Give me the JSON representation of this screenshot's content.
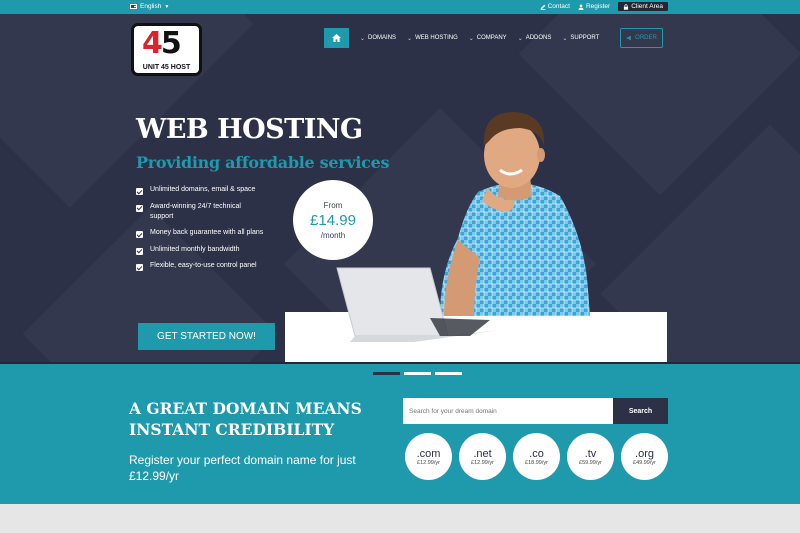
{
  "topbar": {
    "language": "English",
    "contact": "Contact",
    "register": "Register",
    "client_area": "Client Area"
  },
  "logo": {
    "digits_a": "4",
    "digits_b": "5",
    "text": "UNIT 45 HOST"
  },
  "nav": {
    "items": [
      "DOMAINS",
      "WEB HOSTING",
      "COMPANY",
      "ADDONS",
      "SUPPORT"
    ],
    "order": "ORDER"
  },
  "hero": {
    "title": "WEB HOSTING",
    "subtitle": "Providing affordable services",
    "features": [
      "Unlimited domains, email & space",
      "Award-winning 24/7 technical support",
      "Money back guarantee with all plans",
      "Unlimited monthly bandwidth",
      "Flexible, easy-to-use control panel"
    ],
    "cta": "GET STARTED NOW!",
    "price_from": "From",
    "price": "£14.99",
    "price_period": "/month"
  },
  "slider": {
    "active_index": 0,
    "count": 3
  },
  "domain": {
    "title": "A GREAT DOMAIN MEANS INSTANT CREDIBILITY",
    "subtitle": "Register your perfect domain name for just £12.99/yr",
    "search_placeholder": "Search for your dream domain",
    "search_button": "Search",
    "tlds": [
      {
        "name": ".com",
        "price": "£12.99/yr"
      },
      {
        "name": ".net",
        "price": "£12.99/yr"
      },
      {
        "name": ".co",
        "price": "£18.99/yr"
      },
      {
        "name": ".tv",
        "price": "£59.99/yr"
      },
      {
        "name": ".org",
        "price": "£49.99/yr"
      }
    ]
  },
  "colors": {
    "accent": "#1f9aad",
    "dark": "#2d3148"
  }
}
